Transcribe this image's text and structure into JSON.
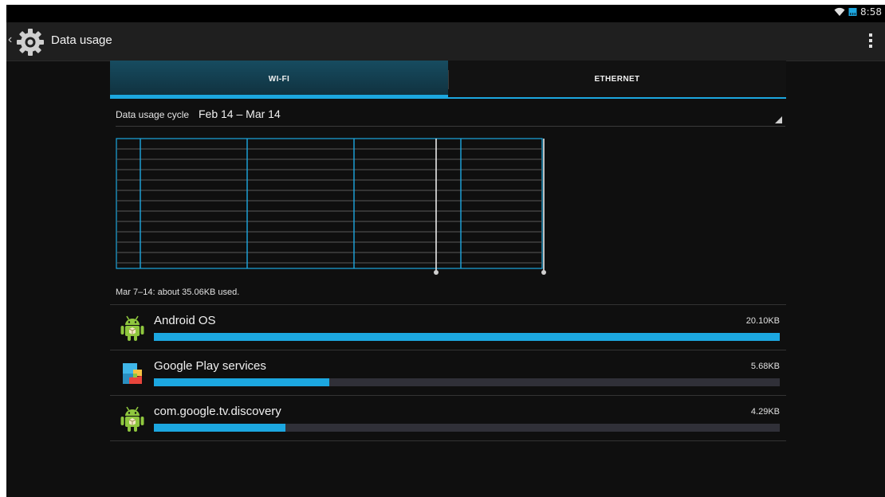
{
  "status": {
    "time": "8:58",
    "icons": [
      "wifi-icon",
      "ethernet-icon"
    ]
  },
  "actionbar": {
    "title": "Data usage",
    "icon": "gear-icon",
    "back_icon": "chevron-left-icon",
    "overflow_icon": "overflow-menu-icon"
  },
  "tabs": [
    {
      "label": "WI-FI",
      "selected": true
    },
    {
      "label": "ETHERNET",
      "selected": false
    }
  ],
  "cycle": {
    "label": "Data usage cycle",
    "value": "Feb 14 – Mar 14"
  },
  "summary": "Mar 7–14: about 35.06KB used.",
  "apps": [
    {
      "name": "Android OS",
      "size": "20.10KB",
      "fraction": 1.0,
      "icon": "android-icon"
    },
    {
      "name": "Google Play services",
      "size": "5.68KB",
      "fraction": 0.28,
      "icon": "google-play-services-icon"
    },
    {
      "name": "com.google.tv.discovery",
      "size": "4.29KB",
      "fraction": 0.21,
      "icon": "android-icon"
    }
  ],
  "colors": {
    "accent": "#1ca7e0",
    "background": "#0f0f0f",
    "actionbar": "#1f1f1f",
    "tab_selected": "#174c60"
  }
}
